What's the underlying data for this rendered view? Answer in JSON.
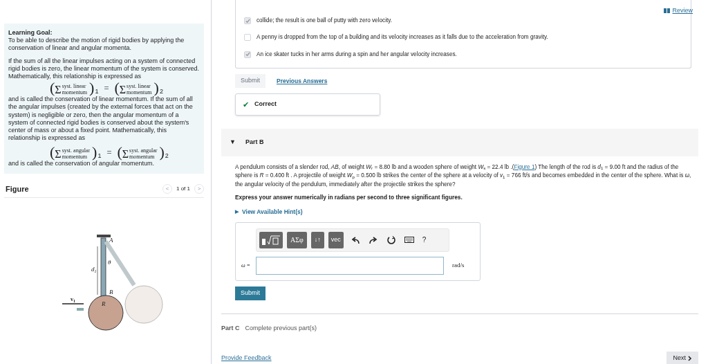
{
  "header": {
    "review_link": "Review"
  },
  "learning_goal": {
    "title": "Learning Goal:",
    "intro": "To be able to describe the motion of rigid bodies by applying the conservation of linear and angular momenta.",
    "paragraph_1": "If the sum of all the linear impulses acting on a system of connected rigid bodies is zero, the linear momentum of the system is conserved. Mathematically, this relationship is expressed as",
    "equation_1": {
      "left": {
        "open": "(",
        "sigma": "Σ",
        "top": "syst. linear",
        "bottom": "momentum",
        "close": ")",
        "index": "1"
      },
      "equals": "=",
      "right": {
        "open": "(",
        "sigma": "Σ",
        "top": "syst. linear",
        "bottom": "momentum",
        "close": ")",
        "index": "2"
      }
    },
    "paragraph_2": "and is called the conservation of linear momentum. If the sum of all the angular impulses (created by the external forces that act on the system) is negligible or zero, then the angular momentum of a system of connected rigid bodies is conserved about the system's center of mass or about a fixed point. Mathematically, this relationship is expressed as",
    "equation_2": {
      "left": {
        "open": "(",
        "sigma": "Σ",
        "top": "syst. angular",
        "bottom": "momentum",
        "close": ")",
        "index": "1"
      },
      "equals": "=",
      "right": {
        "open": "(",
        "sigma": "Σ",
        "top": "syst. angular",
        "bottom": "momentum",
        "close": ")",
        "index": "2"
      }
    },
    "paragraph_3": "and is called the conservation of angular momentum."
  },
  "figure": {
    "title": "Figure",
    "pager": "1 of 1",
    "prev": "<",
    "next": ">",
    "labels": {
      "a": "A",
      "b": "B",
      "theta": "θ",
      "d": "d$_{1}$",
      "r": "R",
      "v": "v$_{1}$"
    }
  },
  "part_a": {
    "options": [
      {
        "text": "collide; the result is one ball of putty with zero velocity.",
        "checked": true
      },
      {
        "text": "A penny is dropped from the top of a building and its velocity increases as it falls due to the acceleration from gravity.",
        "checked": false
      },
      {
        "text": "An ice skater tucks in her arms during a spin and her angular velocity increases.",
        "checked": true
      }
    ],
    "submit": {
      "label": "Submit",
      "disabled": true
    },
    "previous_answers": "Previous Answers",
    "feedback": {
      "mark": "✔",
      "label": "Correct"
    }
  },
  "part_b": {
    "caret": "▼",
    "title": "Part B",
    "expanded": true,
    "problem_before": "A pendulum consists of a slender rod, *AB*, of weight *W*$_{r}$ = 8.80 lb and a wooden sphere of weight *W*$_{s}$ = 22.4 lb .(",
    "figure_link": "Figure 1",
    "problem_after": ") The length of the rod is *d*$_{1}$ = 9.00 ft and the radius of the sphere is *R* = 0.400 ft . A projectile of weight *W*$_{p}$ = 0.500 lb strikes the center of the sphere at a velocity of *v*$_{1}$ = 766 ft/s and becomes embedded in the center of the sphere. What is *ω*, the angular velocity of the pendulum, immediately after the projectile strikes the sphere?",
    "instruction": "Express your answer numerically in radians per second to three significant figures.",
    "hints": {
      "caret": "▶",
      "label": "View Available Hint(s)"
    },
    "toolbar": [
      "ΑΣφ",
      "↓↑",
      "vec",
      "?"
    ],
    "answer": {
      "label": "ω =",
      "unit": "rad/s"
    },
    "submit": {
      "label": "Submit",
      "disabled": false
    }
  },
  "part_c": {
    "title": "Part C",
    "status": "Complete previous part(s)"
  },
  "footer": {
    "feedback_link": "Provide Feedback",
    "next": "Next"
  }
}
